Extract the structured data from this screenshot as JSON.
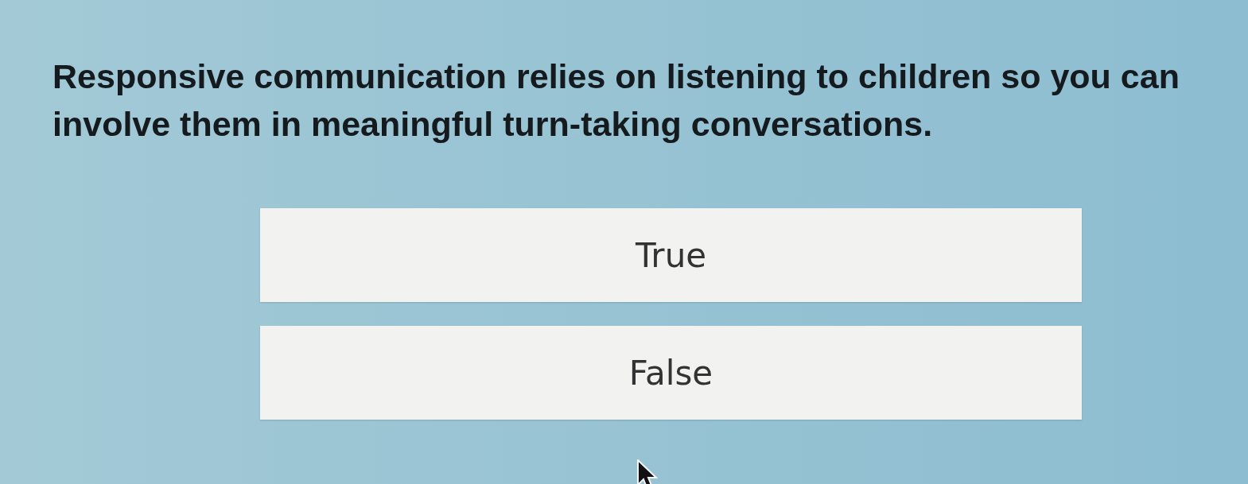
{
  "question": {
    "text": "Responsive communication relies on listening to children so you can involve them in meaningful turn-taking conversations."
  },
  "options": [
    {
      "label": "True",
      "selected": false
    },
    {
      "label": "False",
      "selected": false
    }
  ]
}
